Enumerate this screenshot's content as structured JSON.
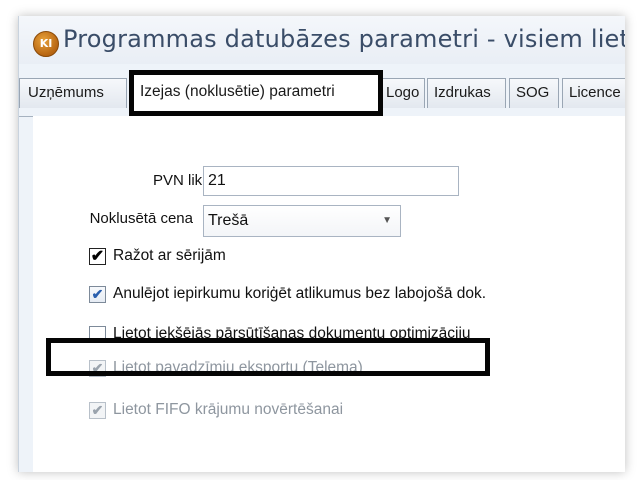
{
  "window": {
    "icon_text": "KI",
    "title": "Programmas datubāzes parametri - visiem lietotājiem"
  },
  "tabs": [
    {
      "label": "Uzņēmums",
      "active": false
    },
    {
      "label": "Izejas (noklusētie) parametri",
      "active": true
    },
    {
      "label": "Logo",
      "active": false
    },
    {
      "label": "Izdrukas",
      "active": false
    },
    {
      "label": "SOG",
      "active": false
    },
    {
      "label": "Licence",
      "active": false
    }
  ],
  "form": {
    "vat_rate_label": "PVN likme",
    "vat_rate_value": "21",
    "default_price_label": "Noklusētā cena",
    "default_price_value": "Trešā"
  },
  "checkboxes": [
    {
      "label": "Ražot ar sērijām",
      "checked": true,
      "enabled": true
    },
    {
      "label": "Anulējot iepirkumu koriģēt atlikumus bez labojošā dok.",
      "checked": true,
      "enabled": true
    },
    {
      "label": "Lietot iekšējās pārsūtīšanas dokumentu optimizāciju",
      "checked": false,
      "enabled": true
    },
    {
      "label": "Lietot pavadzīmju eksportu (Telema)",
      "checked": true,
      "enabled": false
    },
    {
      "label": "Lietot FIFO krājumu novērtēšanai",
      "checked": true,
      "enabled": false
    }
  ],
  "glyphs": {
    "check": "✔",
    "dropdown_arrow": "▼"
  },
  "colors": {
    "title_text": "#3a4d68",
    "checkbox_check": "#2a5fae",
    "highlight_border": "#050505"
  }
}
